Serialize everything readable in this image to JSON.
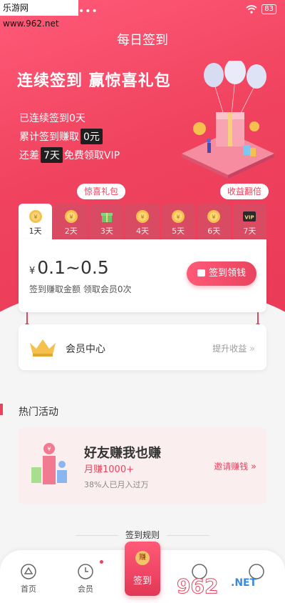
{
  "status_bar": {
    "watermark": "乐游网 www.962.net",
    "dots": "•••",
    "battery": "83"
  },
  "title": "每日签到",
  "headline": "连续签到 赢惊喜礼包",
  "stats": {
    "streak": "已连续签到0天",
    "earned_prefix": "累计签到赚取",
    "earned_value": "0元",
    "vip_prefix": "还差",
    "vip_days": "7天",
    "vip_suffix": "免费领取VIP"
  },
  "tags": {
    "gift": "惊喜礼包",
    "double": "收益翻倍"
  },
  "days": [
    {
      "label": "1天",
      "icon": "coin-icon",
      "active": true
    },
    {
      "label": "2天",
      "icon": "coin-icon"
    },
    {
      "label": "3天",
      "icon": "gift-icon"
    },
    {
      "label": "4天",
      "icon": "coin-icon"
    },
    {
      "label": "5天",
      "icon": "coin-icon"
    },
    {
      "label": "6天",
      "icon": "coin-icon"
    },
    {
      "label": "7天",
      "icon": "vip-icon",
      "badge": "VIP"
    }
  ],
  "reward": {
    "currency": "¥",
    "range": "0.1~0.5",
    "subtitle": "签到赚取金额  领取会员0次",
    "button": "签到领钱"
  },
  "member": {
    "label": "会员中心",
    "action": "提升收益"
  },
  "hot": {
    "title": "热门活动"
  },
  "activity": {
    "title": "好友赚我也赚",
    "subtitle": "月赚1000+",
    "note": "38%人已月入过万",
    "action": "邀请赚钱"
  },
  "rules": "签到规则",
  "tabbar": {
    "home": "首页",
    "member": "会员",
    "sign": "签到",
    "sign_seal": "赚"
  },
  "colors": {
    "brand": "#e9435f",
    "brand_light": "#ff5a78"
  }
}
